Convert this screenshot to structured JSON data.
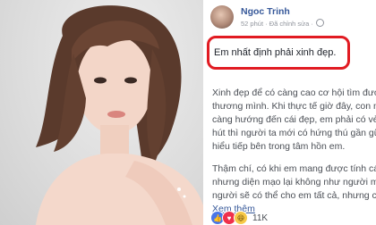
{
  "post": {
    "author": "Ngoc Trinh",
    "meta": "52 phút · Đã chỉnh sửa ·",
    "headline": "Em nhất định phải xinh đẹp.",
    "body": [
      "Xinh đẹp để có càng cao cơ hội tìm được",
      "thương mình. Khi thực tế giờ đây, con ng",
      "càng hướng đến cái đẹp, em phải có vẻ",
      "hút thì người ta mới có hứng thú gần gũi",
      "hiểu tiếp bên trong tâm hồn em."
    ],
    "body2": [
      "Thậm chí, có khi em mang được tính các",
      "nhưng diện mạo lại không như người mo",
      "người sẽ có thể cho em tất cả, nhưng chi"
    ],
    "see_more": "Xem thêm",
    "reaction_count": "11K"
  },
  "colors": {
    "highlight": "#e11b22",
    "link": "#365899"
  }
}
